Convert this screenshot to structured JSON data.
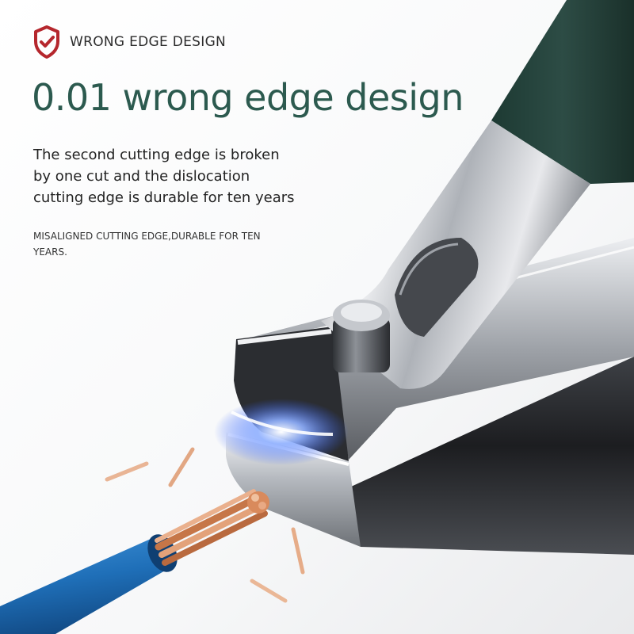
{
  "header": {
    "label": "WRONG EDGE DESIGN",
    "icon": "shield-check-icon",
    "icon_color": "#b5272d"
  },
  "headline": "0.01 wrong edge design",
  "description": "The second cutting edge is broken by one cut and the dislocation cutting edge is durable for ten years",
  "note": "MISALIGNED CUTTING EDGE,DURABLE FOR TEN YEARS.",
  "colors": {
    "headline": "#2c5a4f",
    "handle": "#25423c",
    "steel": "#c9ccd1",
    "cable": "#1f6fb8",
    "copper": "#d98a5c",
    "glow": "#4f7dff"
  }
}
